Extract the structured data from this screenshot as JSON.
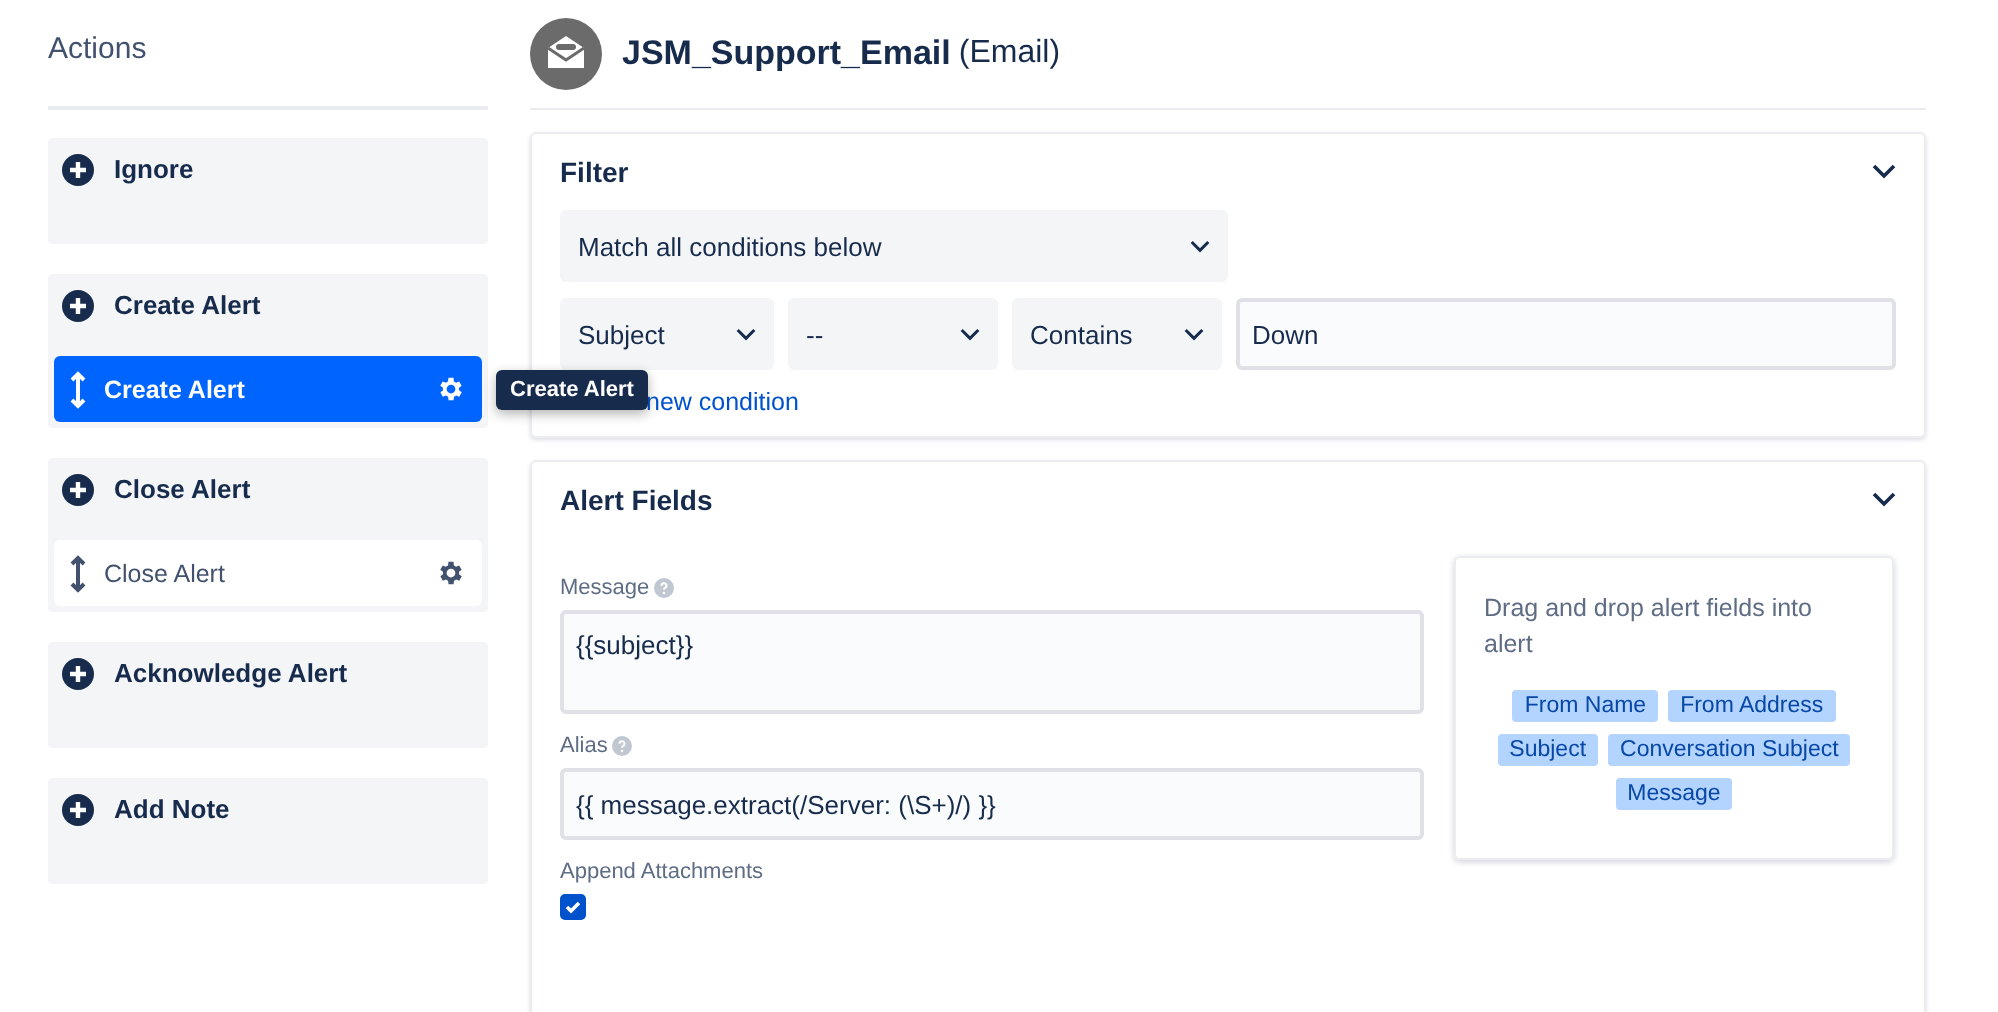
{
  "sidebar": {
    "title": "Actions",
    "groups": [
      {
        "label": "Ignore"
      },
      {
        "label": "Create Alert",
        "children": [
          {
            "label": "Create Alert",
            "selected": true,
            "tooltip": "Create Alert"
          }
        ]
      },
      {
        "label": "Close Alert",
        "children": [
          {
            "label": "Close Alert",
            "selected": false
          }
        ]
      },
      {
        "label": "Acknowledge Alert"
      },
      {
        "label": "Add Note"
      }
    ]
  },
  "header": {
    "title": "JSM_Support_Email",
    "subtitle": "(Email)"
  },
  "filter": {
    "title": "Filter",
    "expanded": true,
    "match": "Match all conditions below",
    "conditions": [
      {
        "field": "Subject",
        "operator_1": "--",
        "operator_2": "Contains",
        "value": "Down"
      }
    ],
    "add_link": "new condition"
  },
  "alert_fields": {
    "title": "Alert Fields",
    "expanded": true,
    "fields": [
      {
        "label": "Message",
        "value": "{{subject}}",
        "kind": "textarea"
      },
      {
        "label": "Alias",
        "value": "{{ message.extract(/Server: (\\S+)/) }}",
        "kind": "input"
      }
    ],
    "append": {
      "label": "Append Attachments",
      "checked": true
    },
    "palette": {
      "hint": "Drag and drop alert fields into alert",
      "tags": [
        "From Name",
        "From Address",
        "Subject",
        "Conversation Subject",
        "Message"
      ]
    }
  }
}
